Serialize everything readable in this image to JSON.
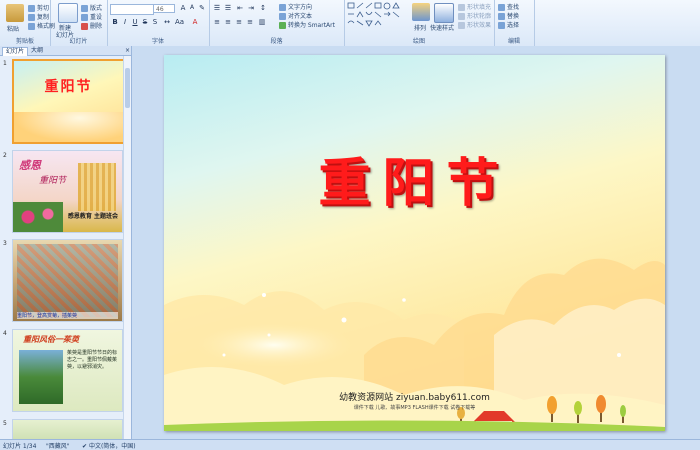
{
  "ribbon": {
    "clipboard": {
      "label": "剪贴板",
      "paste": "粘贴",
      "cut": "剪切",
      "copy": "复制",
      "format": "格式刷"
    },
    "slides": {
      "label": "幻灯片",
      "new": "新建",
      "new2": "幻灯片",
      "layout": "版式",
      "reset": "重设",
      "delete": "删除"
    },
    "font": {
      "label": "字体",
      "size": "46"
    },
    "paragraph": {
      "label": "段落",
      "direction": "文字方向",
      "align": "对齐文本",
      "smartart": "转换为 SmartArt"
    },
    "drawing": {
      "label": "绘图",
      "arrange": "排列",
      "quickstyles": "快速样式",
      "fill": "形状填充",
      "outline": "形状轮廓",
      "effect": "形状效果"
    },
    "editing": {
      "label": "编辑",
      "find": "查找",
      "replace": "替换",
      "select": "选择"
    }
  },
  "panel": {
    "tab_slides": "幻灯片",
    "tab_outline": "大纲",
    "thumbs": [
      {
        "num": "1",
        "title": "重阳节"
      },
      {
        "num": "2",
        "title": "感恩",
        "subtitle": "重阳节",
        "caption": "感恩教育 主题班会"
      },
      {
        "num": "3",
        "caption": "重阳节，登高赏菊，插茱萸"
      },
      {
        "num": "4",
        "title": "重阳风俗一茱萸",
        "body": "茱萸是重阳节节日的标志之一。重阳节佩戴茱萸，以避邪消灾。"
      },
      {
        "num": "5"
      }
    ]
  },
  "slide": {
    "title": "重阳节",
    "site": "幼教资源网站  ziyuan.baby611.com",
    "sub": "课件下载    儿歌、故事MP3    FLASH课件下载    试卷下载等"
  },
  "status": {
    "slide": "幻灯片 1/34",
    "theme": "\"西藏风\"",
    "lang": "中文(简体，中国)"
  },
  "colors": {
    "title": "#ff1b1b",
    "selection": "#f0a030"
  }
}
